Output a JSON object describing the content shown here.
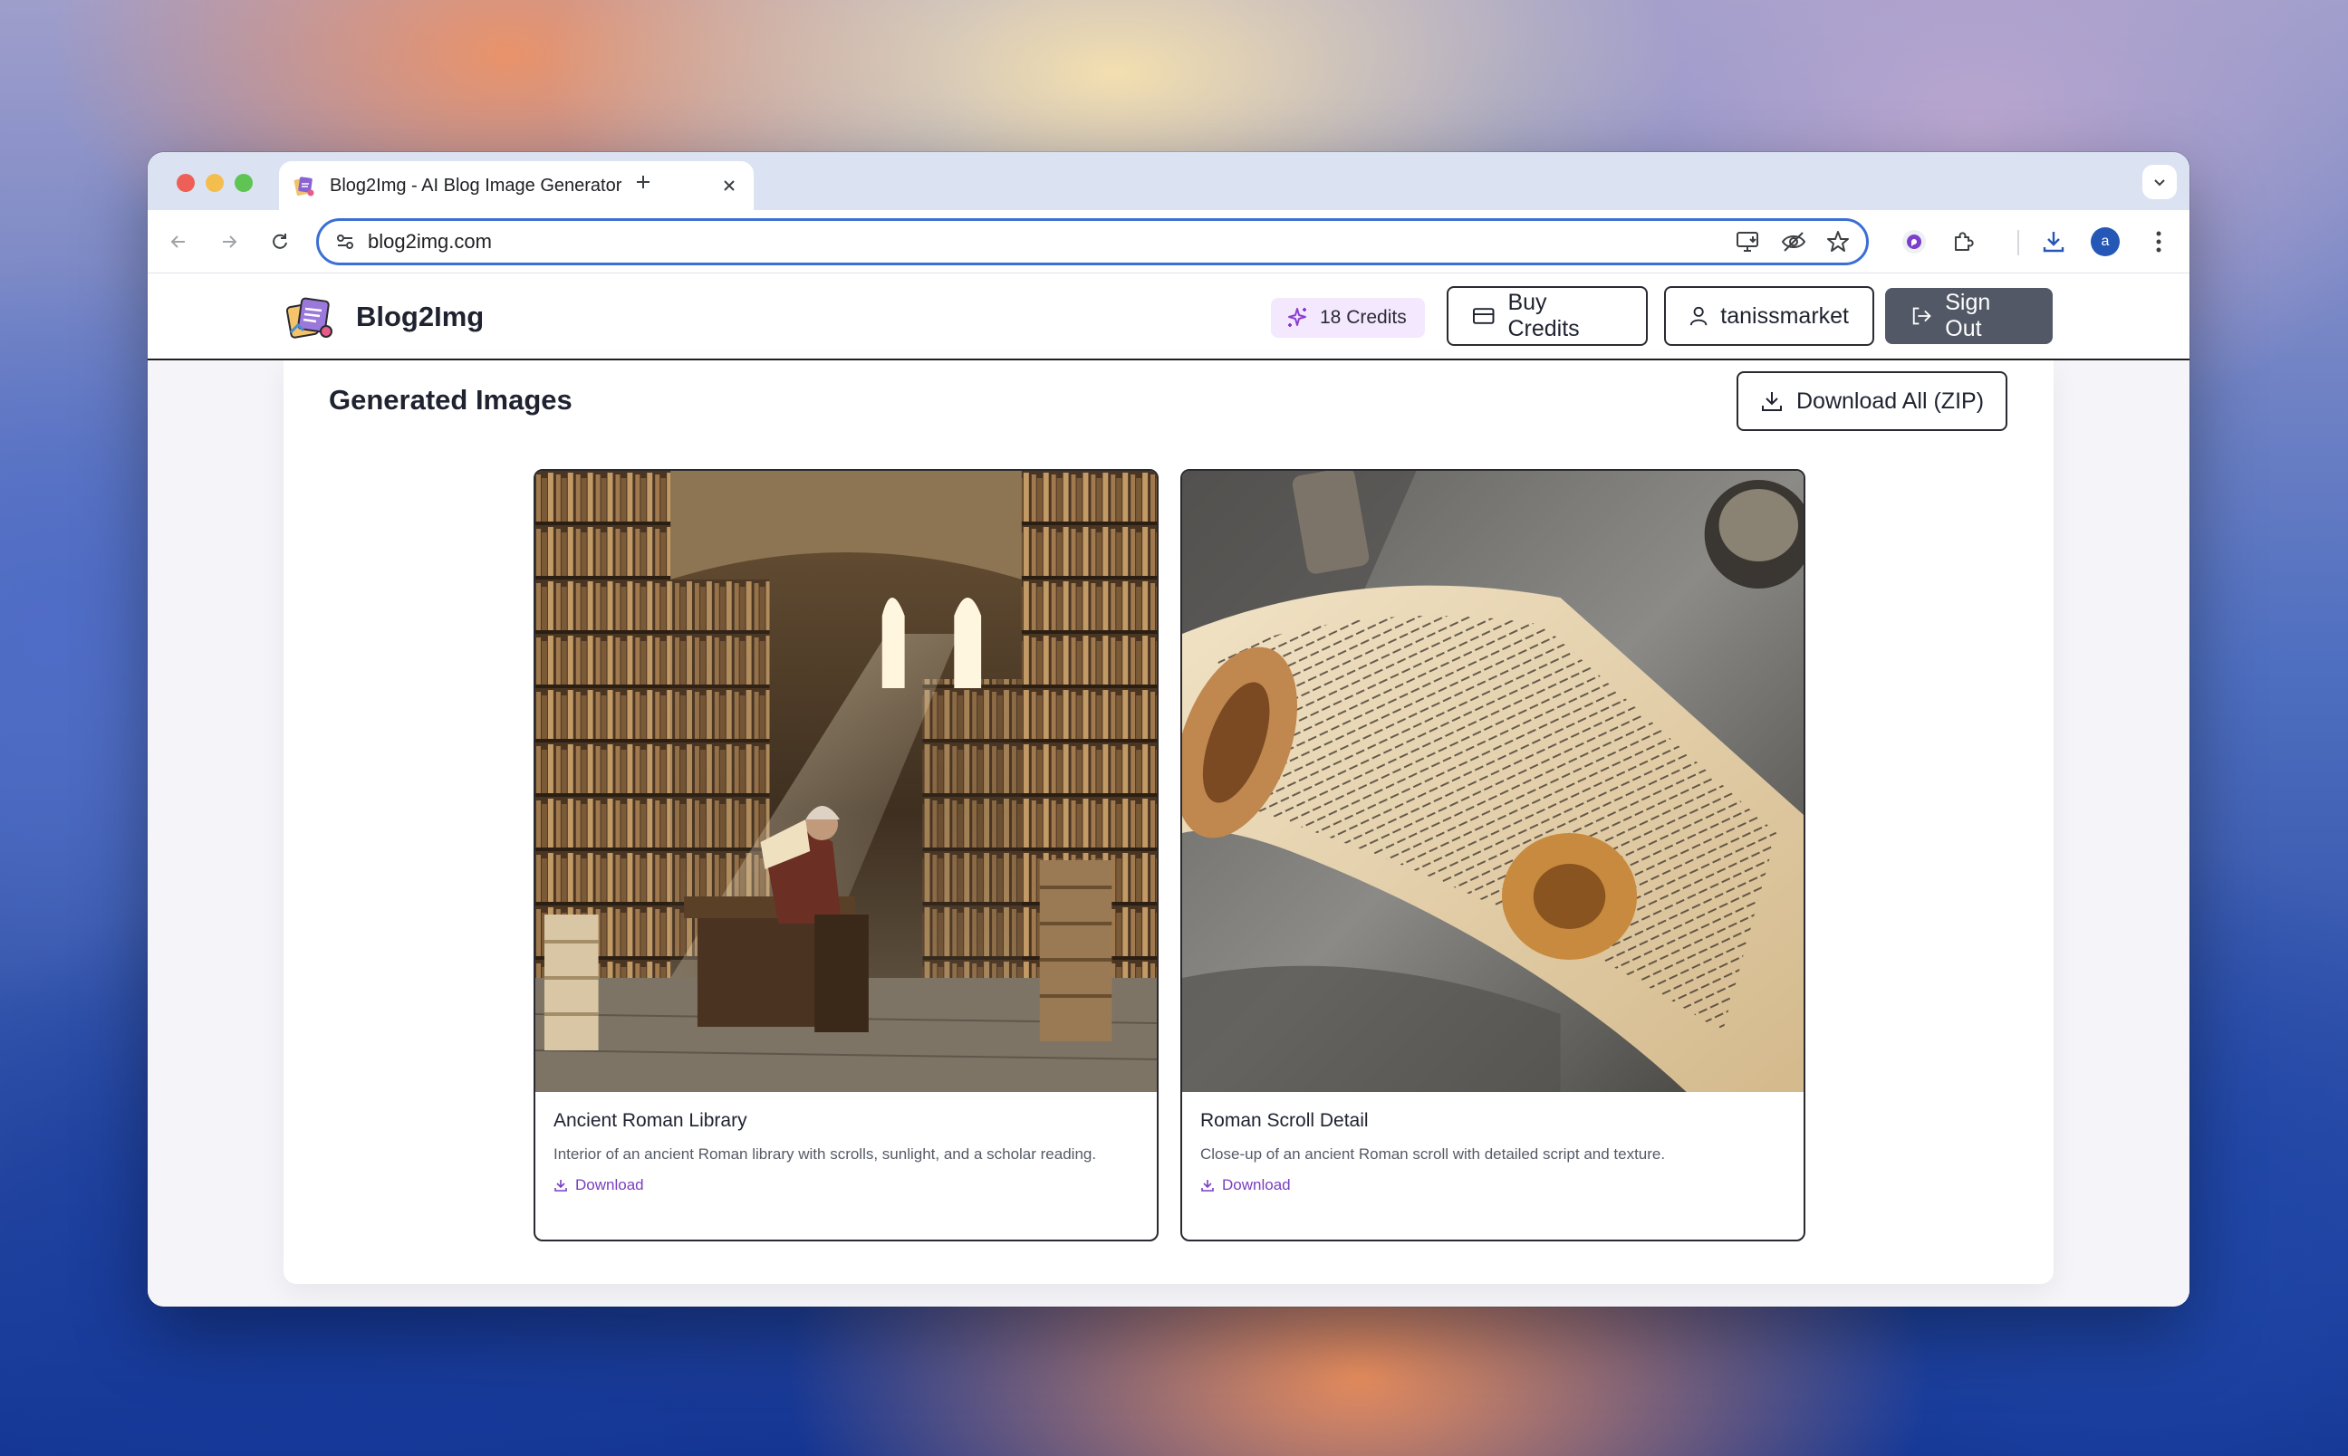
{
  "browser": {
    "tab_title": "Blog2Img - AI Blog Image Generator",
    "url": "blog2img.com",
    "profile_initial": "a"
  },
  "app": {
    "brand_name": "Blog2Img",
    "credits_label": "18 Credits",
    "buy_credits_label": "Buy Credits",
    "username": "tanissmarket",
    "sign_out_label": "Sign Out"
  },
  "gallery": {
    "title": "Generated Images",
    "download_all_label": "Download All (ZIP)",
    "images": [
      {
        "title": "Ancient Roman Library",
        "description": "Interior of an ancient Roman library with scrolls, sunlight, and a scholar reading.",
        "download_label": "Download"
      },
      {
        "title": "Roman Scroll Detail",
        "description": "Close-up of an ancient Roman scroll with detailed script and texture.",
        "download_label": "Download"
      }
    ]
  },
  "colors": {
    "accent": "#3b6fd4",
    "credits_bg": "#f3e8fd",
    "download_link": "#7a3fc0",
    "sign_out_bg": "#525866"
  }
}
